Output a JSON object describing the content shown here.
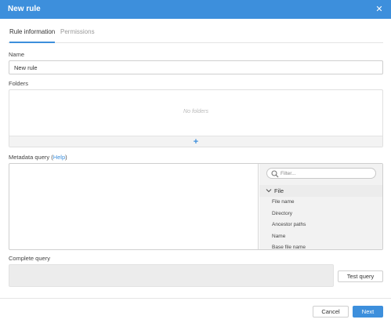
{
  "dialog": {
    "title": "New rule",
    "close_icon": "close-icon"
  },
  "tabs": [
    {
      "label": "Rule information",
      "active": true
    },
    {
      "label": "Permissions",
      "active": false
    }
  ],
  "name": {
    "label": "Name",
    "value": "New rule"
  },
  "folders": {
    "label": "Folders",
    "empty_text": "No folders",
    "add_icon": "plus-icon"
  },
  "metadata_query": {
    "label": "Metadata query",
    "help_open": "(",
    "help_link": "Help",
    "help_close": ")",
    "filter_placeholder": "Filter...",
    "group": {
      "title": "File",
      "expanded": true
    },
    "fields": [
      "File name",
      "Directory",
      "Ancestor paths",
      "Name",
      "Base file name"
    ]
  },
  "complete_query": {
    "label": "Complete query",
    "value": "",
    "test_button": "Test query"
  },
  "footer": {
    "cancel_label": "Cancel",
    "next_label": "Next"
  },
  "colors": {
    "accent": "#3d8fdc",
    "header_bg": "#3d8fdc",
    "panel_bg": "#f2f2f2"
  }
}
